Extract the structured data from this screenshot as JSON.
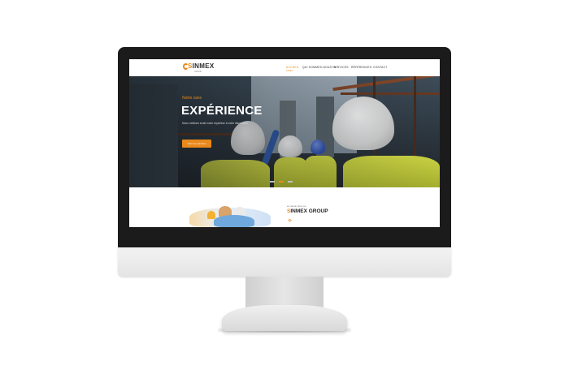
{
  "nav": {
    "logo_text": "INMEX",
    "logo_initial": "S",
    "logo_sub": "GROUP",
    "items": [
      {
        "label": "ACCUEIL",
        "active": true
      },
      {
        "label": "QUI SOMMES-NOUS?",
        "active": false
      },
      {
        "label": "SERVICES",
        "active": false
      },
      {
        "label": "RÉFÉRENCES",
        "active": false
      },
      {
        "label": "CONTACT",
        "active": false
      }
    ],
    "active_sub": "SINEX"
  },
  "hero": {
    "kicker": "Notre sans",
    "title": "EXPÉRIENCE",
    "subtitle": "Nous mettons toute notre expertise à votre disposition",
    "button_label": "Voir nos services",
    "slides": 3,
    "active_slide": 1
  },
  "about": {
    "kicker": "en savoir plus sur",
    "title_initial": "S",
    "title_rest": "INMEX GROUP",
    "icon": "diamond-icon"
  },
  "colors": {
    "accent": "#e8891c",
    "bezel": "#1b1b1b",
    "vest": "#c9d23c"
  }
}
